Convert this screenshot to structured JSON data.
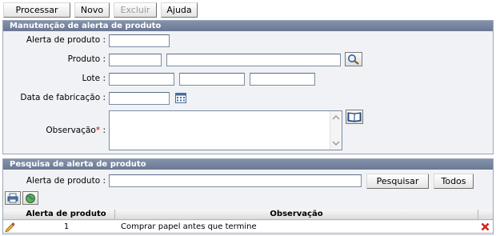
{
  "toolbar": {
    "processar": "Processar",
    "novo": "Novo",
    "excluir": "Excluir",
    "ajuda": "Ajuda"
  },
  "maintenance": {
    "title": "Manutenção de alerta de produto",
    "alerta_label": "Alerta de produto :",
    "produto_label": "Produto :",
    "lote_label": "Lote :",
    "data_label": "Data de fabricação :",
    "observacao_label": "Observação",
    "observacao_suffix": " :",
    "required_mark": "*",
    "alerta_value": "",
    "produto_code": "",
    "produto_desc": "",
    "lote_1": "",
    "lote_2": "",
    "lote_3": "",
    "data_value": "",
    "observacao_value": ""
  },
  "search": {
    "title": "Pesquisa de alerta de produto",
    "alerta_label": "Alerta de produto :",
    "alerta_value": "",
    "pesquisar": "Pesquisar",
    "todos": "Todos"
  },
  "grid": {
    "columns": [
      "Alerta de produto",
      "Observação"
    ],
    "rows": [
      {
        "alerta": "1",
        "observacao": "Comprar papel antes que termine"
      }
    ]
  },
  "icons": {
    "search": "magnifier-icon",
    "calendar": "calendar-icon",
    "book": "book-icon",
    "print": "printer-icon",
    "export": "globe-icon",
    "edit": "pencil-icon",
    "delete": "red-x-icon"
  },
  "colors": {
    "panel_header": "#6c7892",
    "panel_bg": "#f0f2f5",
    "required": "#cc0000",
    "delete": "#d42020"
  }
}
